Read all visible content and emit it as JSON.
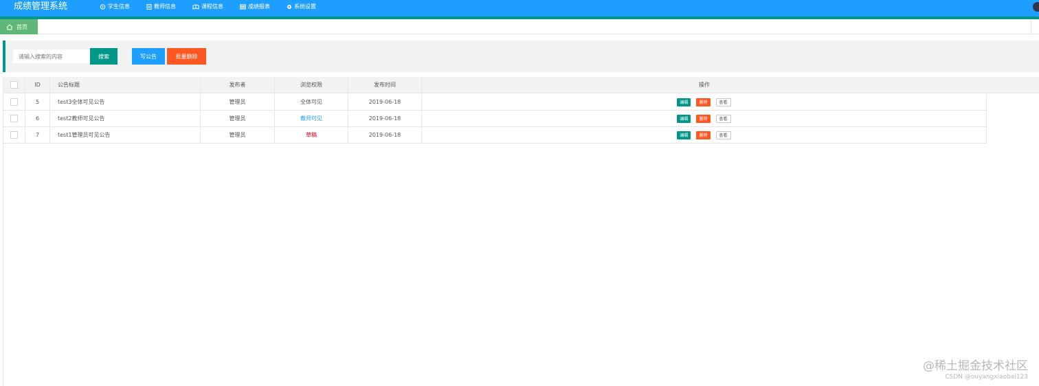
{
  "header": {
    "title": "成绩管理系统",
    "nav": [
      {
        "label": "学生信息",
        "icon": "student-icon"
      },
      {
        "label": "教师信息",
        "icon": "teacher-icon"
      },
      {
        "label": "课程信息",
        "icon": "course-icon"
      },
      {
        "label": "成绩报表",
        "icon": "report-icon"
      },
      {
        "label": "系统设置",
        "icon": "gear-icon"
      }
    ],
    "colors": {
      "primary": "#1e9fff",
      "accent": "#009688"
    }
  },
  "tabs": {
    "home_label": "首页"
  },
  "toolbar": {
    "search_placeholder": "请输入搜索的内容",
    "search_label": "搜索",
    "write_label": "写公告",
    "batch_delete_label": "批量删除"
  },
  "table": {
    "headers": {
      "id": "ID",
      "title": "公告标题",
      "publisher": "发布者",
      "permission": "浏览权限",
      "time": "发布时间",
      "ops": "操作"
    },
    "rows": [
      {
        "id": "5",
        "title": "test3全体可见公告",
        "publisher": "管理员",
        "permission": "全体可见",
        "time": "2019-06-18"
      },
      {
        "id": "6",
        "title": "test2教师可见公告",
        "publisher": "管理员",
        "permission": "教师可见",
        "time": "2019-06-18"
      },
      {
        "id": "7",
        "title": "test1管理员可见公告",
        "publisher": "管理员",
        "permission": "草稿",
        "time": "2019-06-18"
      }
    ],
    "row_actions": {
      "edit": "编辑",
      "delete": "删除",
      "view": "查看"
    }
  },
  "watermark": {
    "main": "@稀土掘金技术社区",
    "sub": "CSDN @ouyangxiaobai123"
  }
}
